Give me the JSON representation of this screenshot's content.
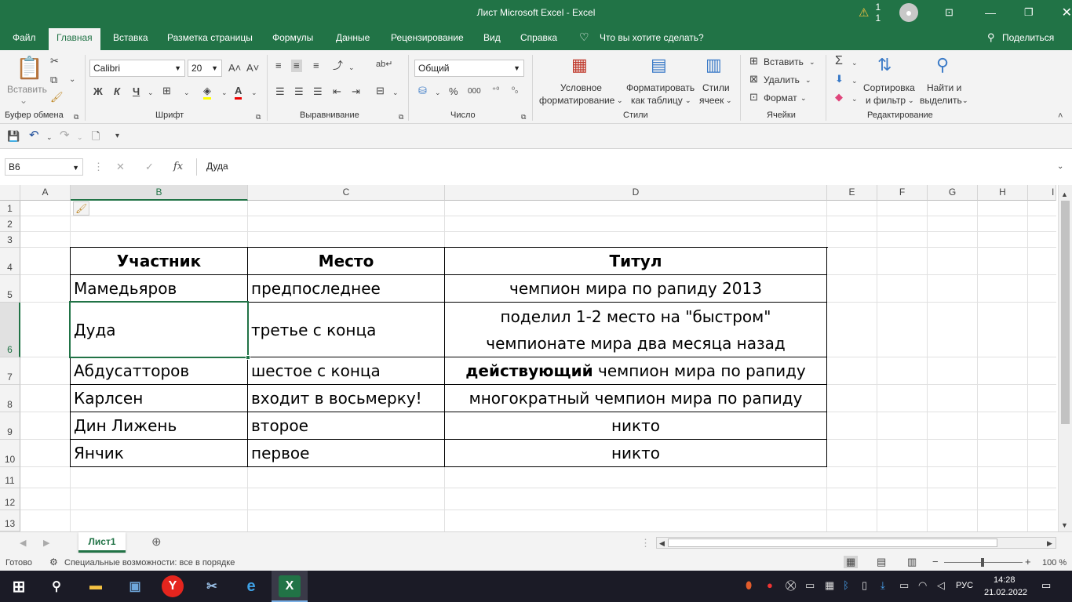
{
  "window": {
    "title": "Лист Microsoft Excel  -  Excel",
    "warning_count": "1 1",
    "colors": {
      "brand": "#217346",
      "grid": "#e1e1e1"
    }
  },
  "ribbon_tabs": [
    "Файл",
    "Главная",
    "Вставка",
    "Разметка страницы",
    "Формулы",
    "Данные",
    "Рецензирование",
    "Вид",
    "Справка",
    "Что вы хотите сделать?"
  ],
  "share_label": "Поделиться",
  "ribbon": {
    "paste_label": "Вставить",
    "font_name": "Calibri",
    "font_size": "20",
    "bold": "Ж",
    "italic": "К",
    "underline": "Ч",
    "number_format": "Общий",
    "percent": "%",
    "thousands": "000",
    "conditional_1": "Условное",
    "conditional_2": "форматирование",
    "format_table_1": "Форматировать",
    "format_table_2": "как таблицу",
    "styles_1": "Стили",
    "styles_2": "ячеек",
    "insert": "Вставить",
    "delete": "Удалить",
    "format": "Формат",
    "sort_1": "Сортировка",
    "sort_2": "и фильтр",
    "find_1": "Найти и",
    "find_2": "выделить",
    "groups": {
      "clipboard": "Буфер обмена",
      "font": "Шрифт",
      "alignment": "Выравнивание",
      "number": "Число",
      "styles": "Стили",
      "cells": "Ячейки",
      "editing": "Редактирование"
    }
  },
  "formula_bar": {
    "name_box": "B6",
    "fx": "fx",
    "content": "Дуда"
  },
  "columns": [
    "A",
    "B",
    "C",
    "D",
    "E",
    "F",
    "G",
    "H",
    "I"
  ],
  "rows": [
    "1",
    "2",
    "3",
    "4",
    "5",
    "6",
    "7",
    "8",
    "9",
    "10",
    "11",
    "12",
    "13"
  ],
  "table": {
    "headers": [
      "Участник",
      "Место",
      "Титул"
    ],
    "rows": [
      {
        "name": "Мамедьяров",
        "place": "предпоследнее",
        "title": "чемпион мира по рапиду 2013"
      },
      {
        "name": "Дуда",
        "place": "третье с конца",
        "title_line1": "поделил 1-2 место на \"быстром\"",
        "title_line2": "чемпионате мира два месяца назад"
      },
      {
        "name": "Абдусатторов",
        "place": "шестое с конца",
        "title_bold": "действующий",
        "title_rest": " чемпион мира по рапиду"
      },
      {
        "name": "Карлсен",
        "place": "входит в восьмерку!",
        "title": "многократный чемпион мира по рапиду"
      },
      {
        "name": "Дин Лижень",
        "place": "второе",
        "title": "никто"
      },
      {
        "name": "Янчик",
        "place": "первое",
        "title": "никто"
      }
    ]
  },
  "sheet_tab": "Лист1",
  "status": {
    "ready": "Готово",
    "accessibility": "Специальные возможности: все в порядке",
    "zoom": "100 %"
  },
  "taskbar": {
    "lang": "РУС",
    "time": "14:28",
    "date": "21.02.2022"
  }
}
